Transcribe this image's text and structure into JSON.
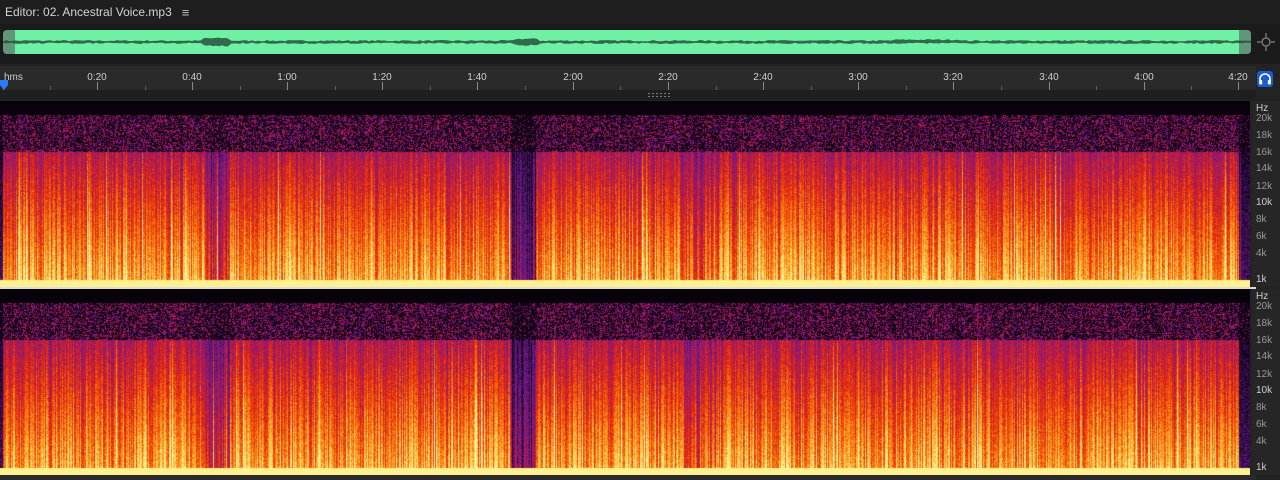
{
  "editor": {
    "title": "Editor: 02. Ancestral Voice.mp3",
    "menu_icon": "hamburger-menu-icon"
  },
  "overview": {
    "color": "#6ff0a5",
    "zoom_icon": "zoom-full-icon"
  },
  "timeline": {
    "format_label": "hms",
    "labels": [
      "0:20",
      "0:40",
      "1:00",
      "1:20",
      "1:40",
      "2:00",
      "2:20",
      "2:40",
      "3:00",
      "3:20",
      "3:40",
      "4:00",
      "4:20"
    ],
    "headphone_icon": "headphones-icon"
  },
  "frequency_axis": {
    "unit": "Hz",
    "labels": [
      "20k",
      "18k",
      "16k",
      "14k",
      "12k",
      "10k",
      "8k",
      "6k",
      "4k",
      "1k"
    ]
  },
  "spectrogram": {
    "channels": 2,
    "palette": [
      "#000000",
      "#2a0a3a",
      "#5a1880",
      "#8b1a7a",
      "#c21a3a",
      "#e8300a",
      "#f56a0a",
      "#fca52a",
      "#ffe36a",
      "#fffbb0"
    ]
  }
}
